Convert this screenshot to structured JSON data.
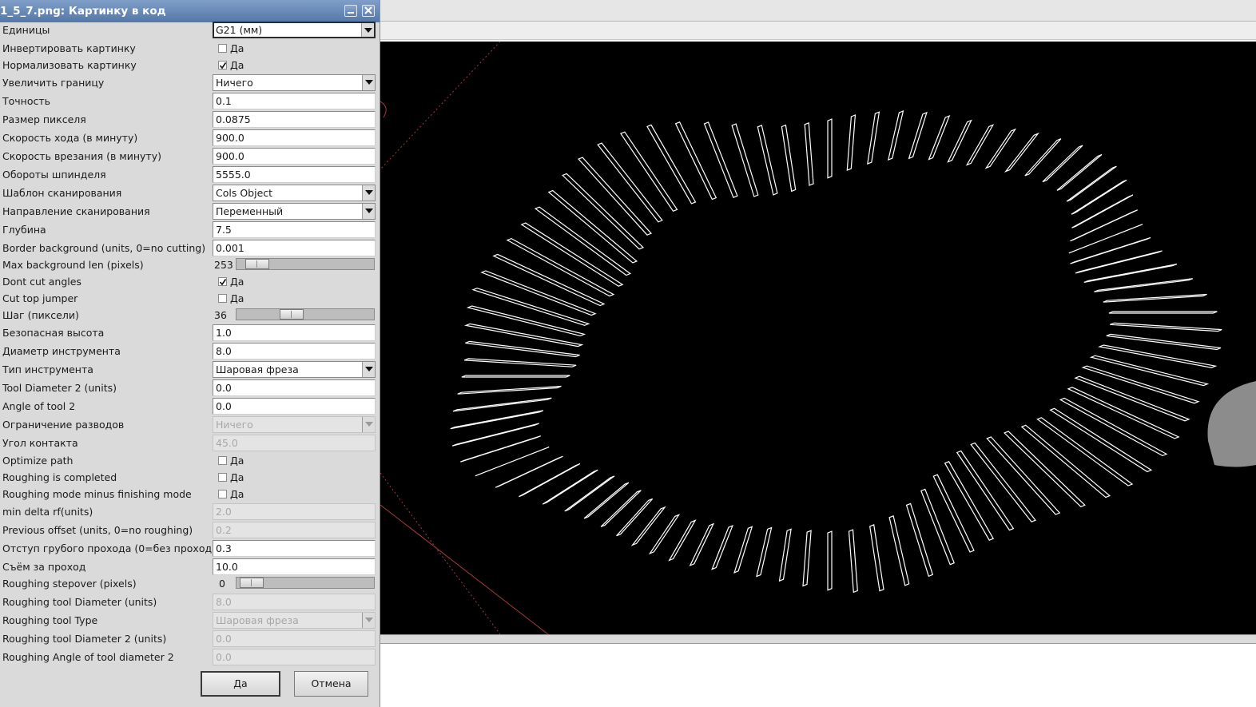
{
  "window": {
    "title": "1_5_7.png: Картинку в код"
  },
  "form": {
    "units": {
      "label": "Единицы",
      "value": "G21 (мм)"
    },
    "invert": {
      "label": "Инвертировать картинку",
      "checked": false,
      "text": "Да"
    },
    "normalize": {
      "label": "Нормализовать картинку",
      "checked": true,
      "text": "Да"
    },
    "expand": {
      "label": "Увеличить границу",
      "value": "Ничего"
    },
    "tolerance": {
      "label": "Точность",
      "value": "0.1"
    },
    "pixel_size": {
      "label": "Размер пикселя",
      "value": "0.0875"
    },
    "feed_rate": {
      "label": "Скорость хода (в минуту)",
      "value": "900.0"
    },
    "plunge_rate": {
      "label": "Скорость врезания (в минуту)",
      "value": "900.0"
    },
    "spindle": {
      "label": "Обороты шпинделя",
      "value": "5555.0"
    },
    "scan_pattern": {
      "label": "Шаблон сканирования",
      "value": "Cols Object"
    },
    "scan_direction": {
      "label": "Направление сканирования",
      "value": "Переменный"
    },
    "depth": {
      "label": "Глубина",
      "value": "7.5"
    },
    "border_bg": {
      "label": "Border background (units, 0=no cutting)",
      "value": "0.001"
    },
    "max_bg_len": {
      "label": "Max background len (pixels)",
      "value": "253",
      "position": 0.05
    },
    "dont_cut_angles": {
      "label": "Dont cut angles",
      "checked": true,
      "text": "Да"
    },
    "cut_top_jumper": {
      "label": "Cut top jumper",
      "checked": false,
      "text": "Да"
    },
    "step": {
      "label": "Шаг (пиксели)",
      "value": "36",
      "position": 0.35
    },
    "safety_height": {
      "label": "Безопасная высота",
      "value": "1.0"
    },
    "tool_diameter": {
      "label": "Диаметр инструмента",
      "value": "8.0"
    },
    "tool_type": {
      "label": "Тип инструмента",
      "value": "Шаровая фреза"
    },
    "tool_diameter2": {
      "label": "Tool Diameter 2 (units)",
      "value": "0.0"
    },
    "tool_angle2": {
      "label": "Angle of tool 2",
      "value": "0.0"
    },
    "cut_limit": {
      "label": "Ограничение разводов",
      "value": "Ничего",
      "disabled": true
    },
    "contact_angle": {
      "label": "Угол контакта",
      "value": "45.0",
      "disabled": true
    },
    "optimize_path": {
      "label": "Optimize path",
      "checked": false,
      "text": "Да"
    },
    "roughing_completed": {
      "label": "Roughing is completed",
      "checked": false,
      "text": "Да"
    },
    "roughing_minus": {
      "label": "Roughing mode minus finishing mode",
      "checked": false,
      "text": "Да"
    },
    "min_delta": {
      "label": "min delta rf(units)",
      "value": "2.0",
      "disabled": true
    },
    "prev_offset": {
      "label": "Previous offset (units, 0=no roughing)",
      "value": "0.2",
      "disabled": true
    },
    "rough_offset": {
      "label": "Отступ грубого прохода (0=без прохода)",
      "value": "0.3"
    },
    "rough_depth": {
      "label": "Съём за проход",
      "value": "10.0"
    },
    "rough_stepover": {
      "label": "Roughing stepover (pixels)",
      "value": "0",
      "position": 0.0
    },
    "rough_tool_diam": {
      "label": "Roughing tool Diameter (units)",
      "value": "8.0",
      "disabled": true
    },
    "rough_tool_type": {
      "label": "Roughing tool Type",
      "value": "Шаровая фреза",
      "disabled": true
    },
    "rough_tool_diam2": {
      "label": "Roughing tool Diameter 2 (units)",
      "value": "0.0",
      "disabled": true
    },
    "rough_angle2": {
      "label": "Roughing Angle of tool diameter 2",
      "value": "0.0",
      "disabled": true
    }
  },
  "buttons": {
    "ok": "Да",
    "cancel": "Отмена"
  },
  "colors": {
    "titlebar": "#5f7fb0",
    "dialog_bg": "#dadada",
    "canvas_bg": "#000000",
    "toolpath": "#ffffff",
    "boundary": "#a03a3a"
  },
  "icons": {
    "minimize": "minimize-icon",
    "close": "close-icon",
    "dropdown": "chevron-down-icon",
    "check": "checkmark-icon"
  }
}
